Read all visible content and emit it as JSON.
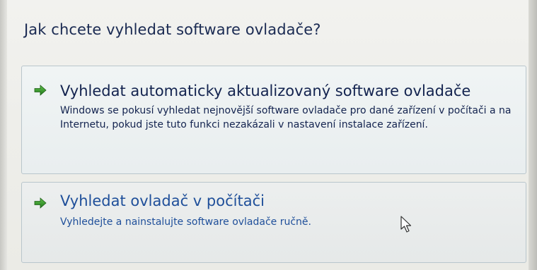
{
  "dialog": {
    "heading": "Jak chcete vyhledat software ovladače?"
  },
  "options": [
    {
      "icon": "green-arrow-icon",
      "title": "Vyhledat automaticky aktualizovaný software ovladače",
      "description": "Windows se pokusí vyhledat nejnovější software ovladače pro dané zařízení v počítači a na Internetu, pokud jste tuto funkci nezakázali v nastavení instalace zařízení."
    },
    {
      "icon": "green-arrow-icon",
      "title": "Vyhledat ovladač v počítači",
      "description": "Vyhledejte a nainstalujte software ovladače ručně."
    }
  ],
  "colors": {
    "heading_text": "#1a2a52",
    "option_text": "#13234f",
    "link_text": "#1f4f9a",
    "arrow": "#3a9a2e"
  }
}
